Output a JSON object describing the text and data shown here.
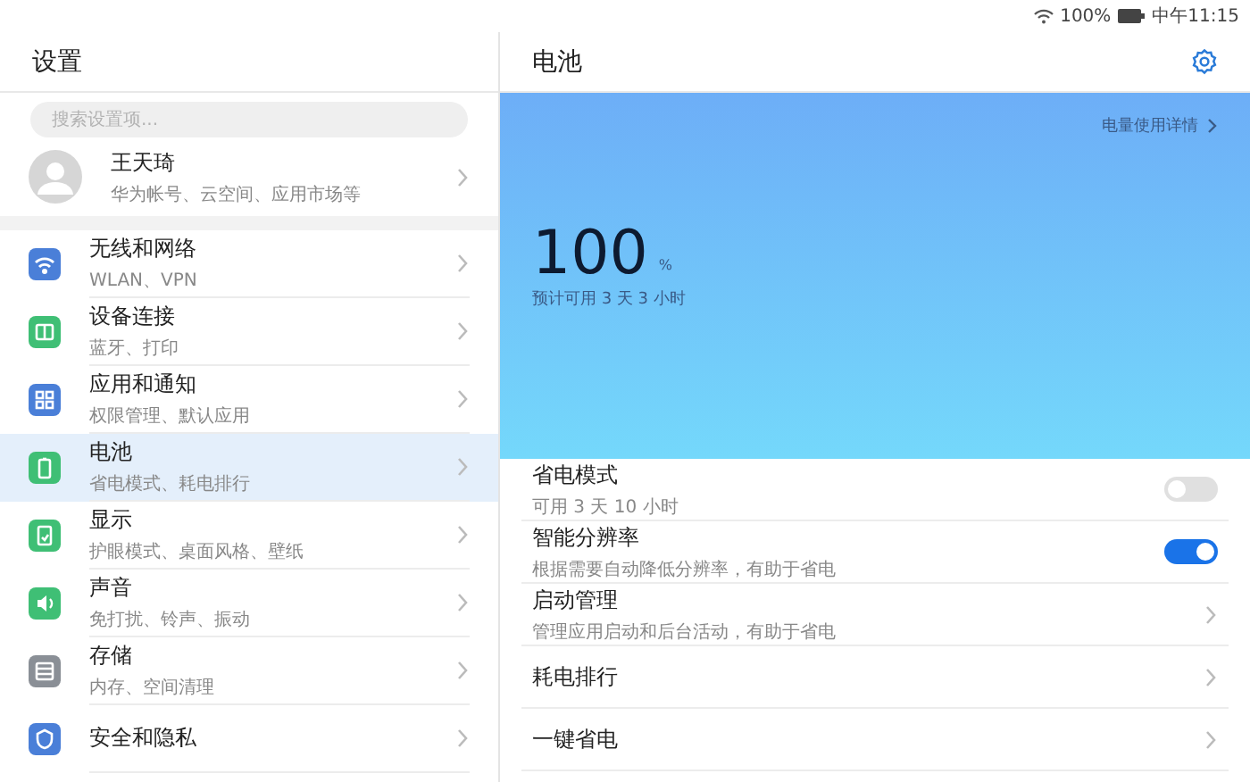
{
  "status_bar": {
    "battery": "100%",
    "time": "中午11:15"
  },
  "sidebar": {
    "title": "设置",
    "search": {
      "placeholder": "搜索设置项..."
    },
    "account": {
      "name": "王天琦",
      "subtitle": "华为帐号、云空间、应用市场等"
    },
    "items": [
      {
        "title": "无线和网络",
        "subtitle": "WLAN、VPN",
        "selected": false
      },
      {
        "title": "设备连接",
        "subtitle": "蓝牙、打印",
        "selected": false
      },
      {
        "title": "应用和通知",
        "subtitle": "权限管理、默认应用",
        "selected": false
      },
      {
        "title": "电池",
        "subtitle": "省电模式、耗电排行",
        "selected": true
      },
      {
        "title": "显示",
        "subtitle": "护眼模式、桌面风格、壁纸",
        "selected": false
      },
      {
        "title": "声音",
        "subtitle": "免打扰、铃声、振动",
        "selected": false
      },
      {
        "title": "存储",
        "subtitle": "内存、空间清理",
        "selected": false
      },
      {
        "title": "安全和隐私",
        "selected": false
      }
    ]
  },
  "detail": {
    "title": "电池",
    "usage_link": "电量使用详情",
    "percent": "100",
    "unit": "%",
    "estimate": "预计可用 3 天 3 小时",
    "rows": [
      {
        "kind": "toggle",
        "title": "省电模式",
        "subtitle": "可用 3 天 10 小时",
        "on": false
      },
      {
        "kind": "toggle",
        "title": "智能分辨率",
        "subtitle": "根据需要自动降低分辨率，有助于省电",
        "on": true
      },
      {
        "kind": "link",
        "title": "启动管理",
        "subtitle": "管理应用启动和后台活动，有助于省电"
      },
      {
        "kind": "link",
        "title": "耗电排行"
      },
      {
        "kind": "link",
        "title": "一键省电"
      }
    ]
  }
}
